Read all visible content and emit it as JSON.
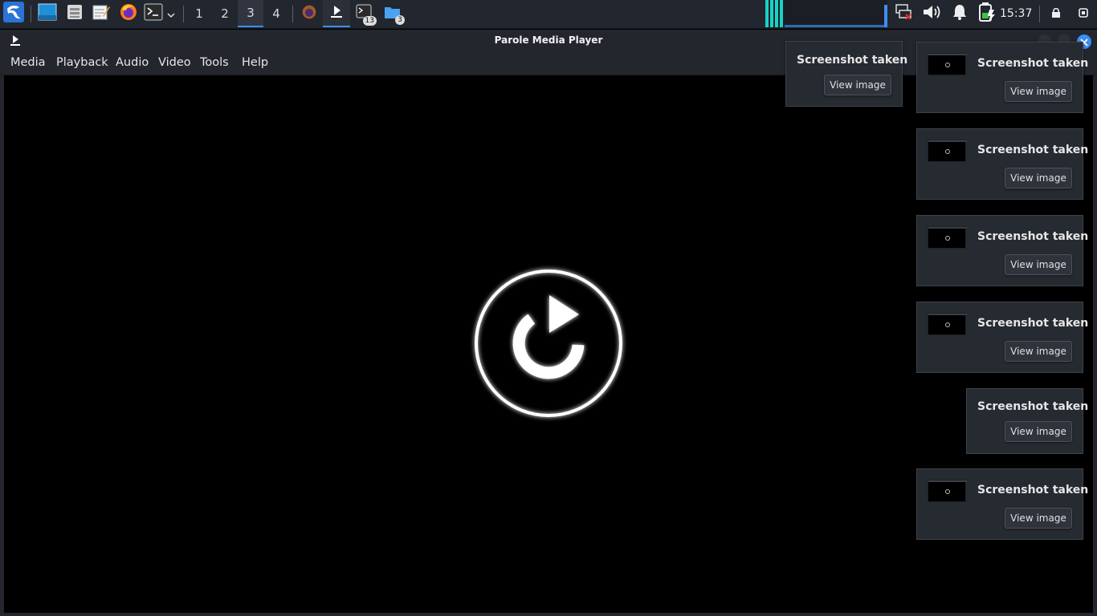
{
  "panel": {
    "workspaces": [
      "1",
      "2",
      "3",
      "4"
    ],
    "active_workspace": "3",
    "clock": "15:37",
    "badges": {
      "terminal_count": "13",
      "files_count": "3"
    },
    "icons": {
      "menu": "kali-dragon-icon",
      "desktop": "show-desktop-icon",
      "files": "file-manager-icon",
      "editor": "text-editor-icon",
      "browser": "firefox-icon",
      "terminal": "terminal-icon",
      "network": "network-disconnected-icon",
      "volume": "volume-icon",
      "notifications": "bell-icon",
      "battery": "battery-charging-icon",
      "lock": "lock-icon",
      "power": "power-icon"
    },
    "accent": "#3d8df5"
  },
  "window": {
    "title": "Parole Media Player",
    "menu": [
      "Media",
      "Playback",
      "Audio",
      "Video",
      "Tools",
      "Help"
    ],
    "center_icon": "reload-icon"
  },
  "notifications": [
    {
      "title": "Screenshot taken",
      "button": "View image"
    },
    {
      "title": "Screenshot taken",
      "button": "View image"
    },
    {
      "title": "Screenshot taken",
      "button": "View image"
    },
    {
      "title": "Screenshot taken",
      "button": "View image"
    },
    {
      "title": "Screenshot taken",
      "button": "View image"
    },
    {
      "title": "Screenshot taken",
      "button": "View image"
    },
    {
      "title": "Screenshot taken",
      "button": "View image"
    }
  ]
}
